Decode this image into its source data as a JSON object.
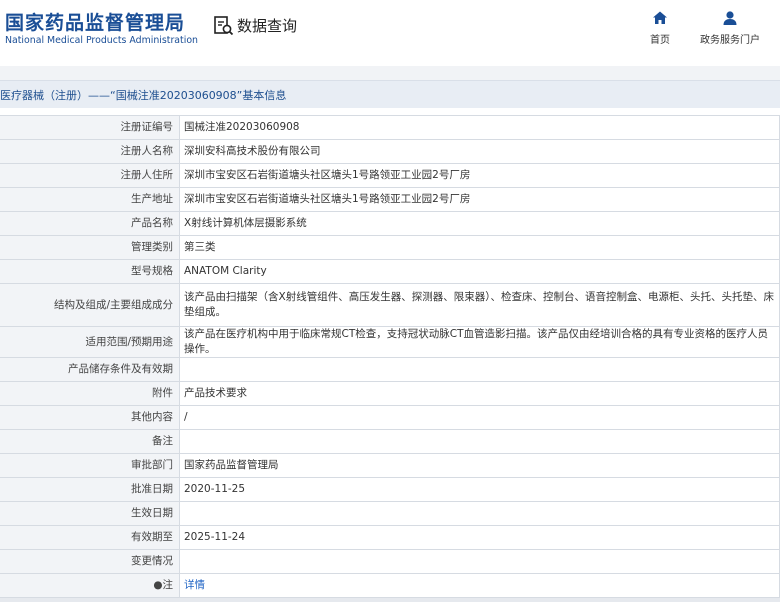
{
  "header": {
    "logo_cn": "国家药品监督管理局",
    "logo_en": "National Medical Products Administration",
    "query_label": "数据查询",
    "nav": [
      {
        "label": "首页",
        "icon": "home-icon"
      },
      {
        "label": "政务服务门户",
        "icon": "user-icon"
      }
    ]
  },
  "breadcrumb": "医疗器械（注册）——“国械注准20203060908”基本信息",
  "rows": [
    {
      "label": "注册证编号",
      "value": "国械注准20203060908"
    },
    {
      "label": "注册人名称",
      "value": "深圳安科高技术股份有限公司"
    },
    {
      "label": "注册人住所",
      "value": "深圳市宝安区石岩街道塘头社区塘头1号路领亚工业园2号厂房"
    },
    {
      "label": "生产地址",
      "value": "深圳市宝安区石岩街道塘头社区塘头1号路领亚工业园2号厂房"
    },
    {
      "label": "产品名称",
      "value": "X射线计算机体层摄影系统"
    },
    {
      "label": "管理类别",
      "value": "第三类"
    },
    {
      "label": "型号规格",
      "value": "ANATOM Clarity"
    },
    {
      "label": "结构及组成/主要组成成分",
      "value": "该产品由扫描架（含X射线管组件、高压发生器、探测器、限束器）、检查床、控制台、语音控制盒、电源柜、头托、头托垫、床垫组成。"
    },
    {
      "label": "适用范围/预期用途",
      "value": "该产品在医疗机构中用于临床常规CT检查，支持冠状动脉CT血管造影扫描。该产品仅由经培训合格的具有专业资格的医疗人员操作。"
    },
    {
      "label": "产品储存条件及有效期",
      "value": ""
    },
    {
      "label": "附件",
      "value": "产品技术要求"
    },
    {
      "label": "其他内容",
      "value": "/"
    },
    {
      "label": "备注",
      "value": ""
    },
    {
      "label": "审批部门",
      "value": "国家药品监督管理局"
    },
    {
      "label": "批准日期",
      "value": "2020-11-25"
    },
    {
      "label": "生效日期",
      "value": ""
    },
    {
      "label": "有效期至",
      "value": "2025-11-24"
    },
    {
      "label": "变更情况",
      "value": ""
    },
    {
      "label": "●注",
      "value": "详情"
    }
  ],
  "colors": {
    "brand": "#1a4e96",
    "link": "#1e63c4",
    "label_bg": "#f2f4f7",
    "crumb_bg": "#e8edf4"
  }
}
